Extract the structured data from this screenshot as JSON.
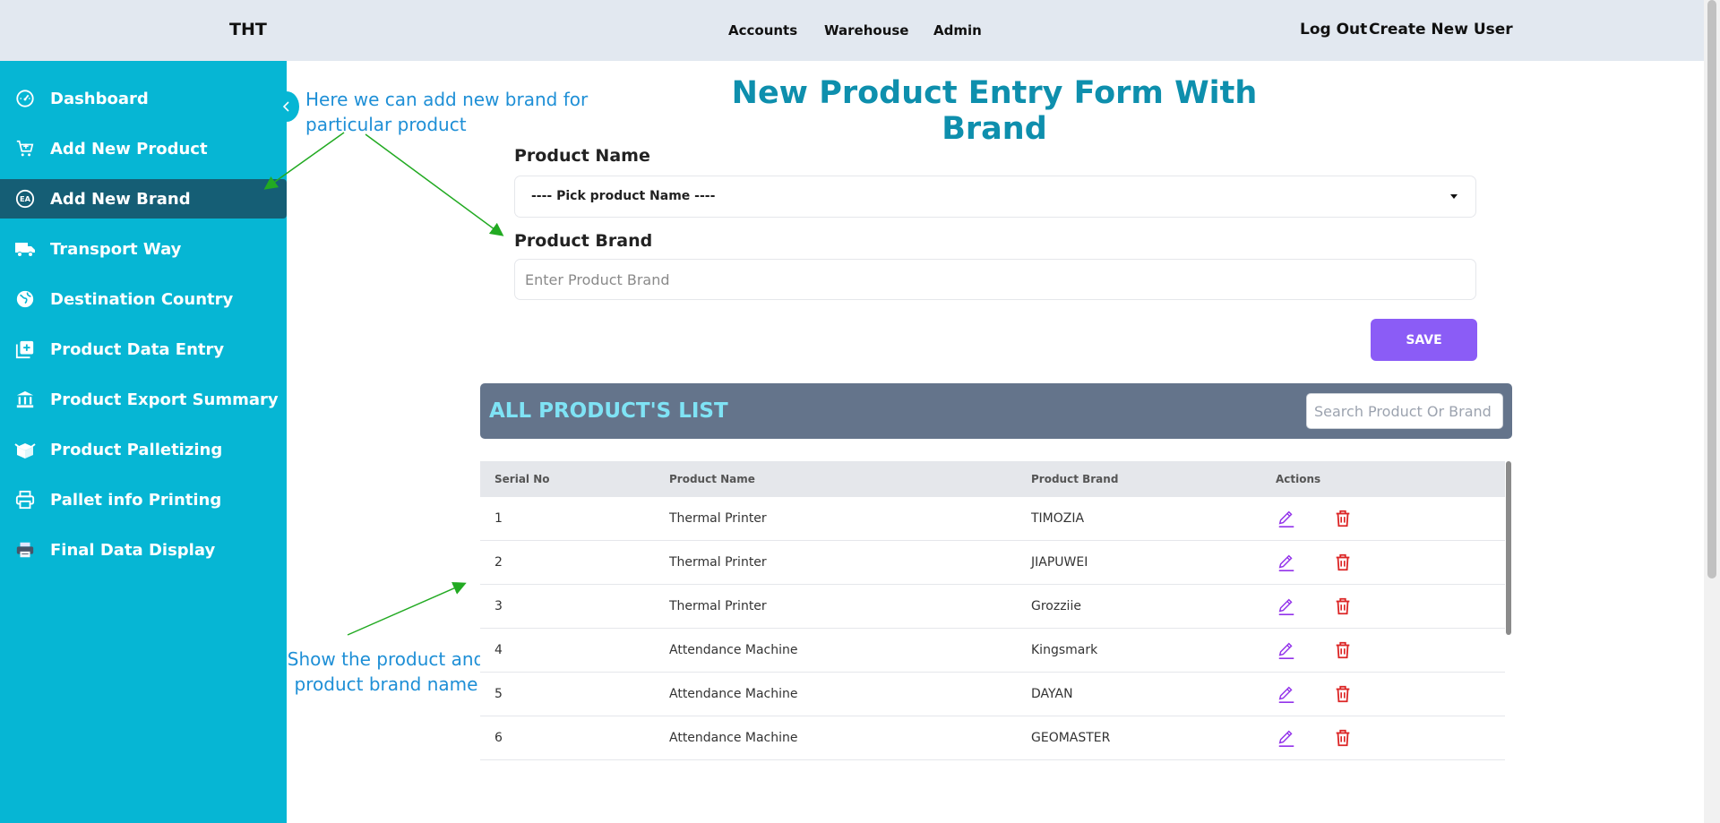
{
  "topbar": {
    "brand": "THT",
    "nav": [
      "Accounts",
      "Warehouse",
      "Admin"
    ],
    "logout": "Log Out",
    "create_user": "Create New User"
  },
  "sidebar": {
    "items": [
      {
        "label": "Dashboard",
        "icon": "dashboard-gauge-icon"
      },
      {
        "label": "Add New Product",
        "icon": "cart-icon"
      },
      {
        "label": "Add New Brand",
        "icon": "ea-brand-icon",
        "active": true
      },
      {
        "label": "Transport Way",
        "icon": "truck-icon"
      },
      {
        "label": "Destination Country",
        "icon": "globe-icon"
      },
      {
        "label": "Product Data Entry",
        "icon": "add-box-icon"
      },
      {
        "label": "Product Export Summary",
        "icon": "bank-icon"
      },
      {
        "label": "Product Palletizing",
        "icon": "package-icon"
      },
      {
        "label": "Pallet info Printing",
        "icon": "printer-icon"
      },
      {
        "label": "Final Data Display",
        "icon": "printer-filled-icon"
      }
    ]
  },
  "annotations": {
    "note_brand": "Here we can add new brand for particular product",
    "note_list": "Show the product and product brand name"
  },
  "form": {
    "title": "New Product Entry Form With Brand",
    "product_name_label": "Product Name",
    "product_name_value": "---- Pick product Name ----",
    "product_brand_label": "Product Brand",
    "product_brand_placeholder": "Enter Product Brand",
    "save_label": "SAVE"
  },
  "list": {
    "title": "ALL PRODUCT'S LIST",
    "search_placeholder": "Search Product Or Brand",
    "columns": [
      "Serial No",
      "Product Name",
      "Product Brand",
      "Actions"
    ],
    "rows": [
      {
        "serial": "1",
        "name": "Thermal Printer",
        "brand": "TIMOZIA"
      },
      {
        "serial": "2",
        "name": "Thermal Printer",
        "brand": "JIAPUWEI"
      },
      {
        "serial": "3",
        "name": "Thermal Printer",
        "brand": "Grozziie"
      },
      {
        "serial": "4",
        "name": "Attendance Machine",
        "brand": "Kingsmark"
      },
      {
        "serial": "5",
        "name": "Attendance Machine",
        "brand": "DAYAN"
      },
      {
        "serial": "6",
        "name": "Attendance Machine",
        "brand": "GEOMASTER"
      }
    ]
  },
  "colors": {
    "sidebar": "#06b6d4",
    "sidebar_active": "#155e75",
    "title": "#0e8fad",
    "save": "#8b5cf6",
    "list_header": "#64748b",
    "edit_icon": "#9333ea",
    "delete_icon": "#dc2626",
    "annotation": "#1e8fd6",
    "arrow": "#22aa22"
  }
}
